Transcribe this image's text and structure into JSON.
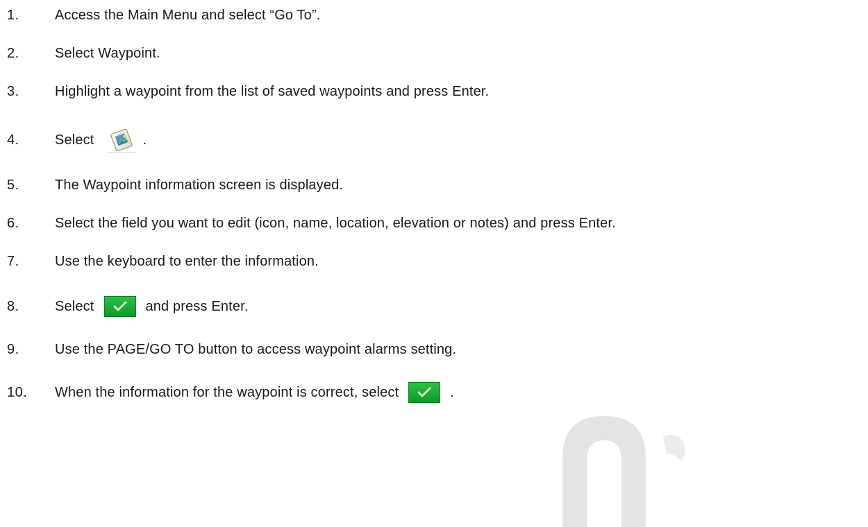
{
  "steps": [
    {
      "num": "1.",
      "text": "Access the Main Menu and select “Go To”."
    },
    {
      "num": "2.",
      "text": "Select Waypoint."
    },
    {
      "num": "3.",
      "text": "Highlight a waypoint from the list of saved waypoints and press Enter."
    },
    {
      "num": "4.",
      "text": "Select",
      "after": ".",
      "icon": "edit-waypoint-icon"
    },
    {
      "num": "5.",
      "text": "The Waypoint information screen is displayed."
    },
    {
      "num": "6.",
      "text": "Select the field you want to edit (icon, name, location, elevation or notes) and press Enter."
    },
    {
      "num": "7.",
      "text": "Use the keyboard to enter the information."
    },
    {
      "num": "8.",
      "text": "Select",
      "after": "and press Enter.",
      "icon": "checkmark-icon"
    },
    {
      "num": "9.",
      "text": "Use the PAGE/GO TO button to access waypoint alarms setting."
    },
    {
      "num": "10.",
      "text": "When the information for the waypoint is correct, select",
      "after": ".",
      "icon": "checkmark-icon"
    }
  ],
  "colors": {
    "text": "#1a1a1a",
    "check_button": "#1faf3a",
    "watermark": "#e2e2e2"
  }
}
